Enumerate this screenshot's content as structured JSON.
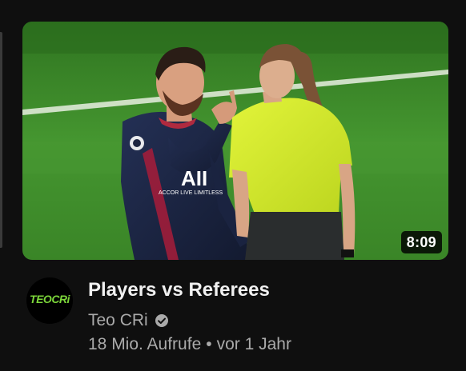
{
  "video": {
    "title": "Players vs Referees",
    "duration": "8:09",
    "channel": {
      "name": "Teo CRi",
      "verified": true,
      "avatar_text": "TEOCRi",
      "verified_icon": "check-circle-icon"
    },
    "views": "18 Mio. Aufrufe",
    "separator": "•",
    "age": "vor 1 Jahr"
  },
  "thumbnail": {
    "jersey_text": "AII",
    "jersey_subtext": "ACCOR LIVE LIMITLESS"
  },
  "colors": {
    "background": "#0f0f0f",
    "title": "#f1f1f1",
    "secondary_text": "#aaaaaa",
    "pitch_green": "#3f8a2a",
    "referee_yellow": "#d6ee2c",
    "jersey_navy": "#1c2440",
    "avatar_logo_green": "#7cd63a"
  }
}
